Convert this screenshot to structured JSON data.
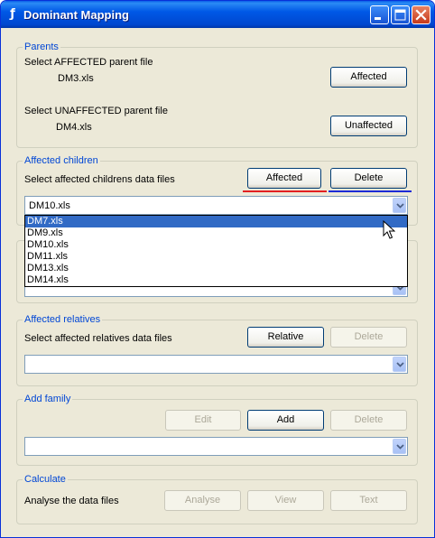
{
  "window": {
    "title": "Dominant Mapping",
    "icon": "app-icon",
    "app_icon_glyph": "ƒ",
    "controls": [
      "minimize",
      "maximize",
      "close"
    ]
  },
  "parents": {
    "legend": "Parents",
    "affected_prompt": "Select AFFECTED parent file",
    "affected_file": "DM3.xls",
    "affected_button": "Affected",
    "unaffected_prompt": "Select UNAFFECTED parent file",
    "unaffected_file": "DM4.xls",
    "unaffected_button": "Unaffected"
  },
  "affected_children": {
    "legend": "Affected children",
    "prompt": "Select affected childrens data files",
    "affected_button": "Affected",
    "delete_button": "Delete",
    "combo_value": "DM10.xls",
    "dropdown_items": [
      "DM7.xls",
      "DM9.xls",
      "DM10.xls",
      "DM11.xls",
      "DM13.xls",
      "DM14.xls"
    ],
    "selected_index": 0
  },
  "affected_relatives": {
    "legend": "Affected relatives",
    "prompt": "Select affected relatives data files",
    "relative_button": "Relative",
    "delete_button": "Delete",
    "combo_value": ""
  },
  "add_family": {
    "legend": "Add family",
    "edit_button": "Edit",
    "add_button": "Add",
    "delete_button": "Delete",
    "combo_value": ""
  },
  "calculate": {
    "legend": "Calculate",
    "prompt": "Analyse the data files",
    "analyse_button": "Analyse",
    "view_button": "View",
    "text_button": "Text"
  },
  "colors": {
    "titlebar": "#0058e6",
    "legend_text": "#0046d5",
    "selection": "#316ac5",
    "annotation_red": "#e32020",
    "annotation_blue": "#1d2bd6"
  }
}
